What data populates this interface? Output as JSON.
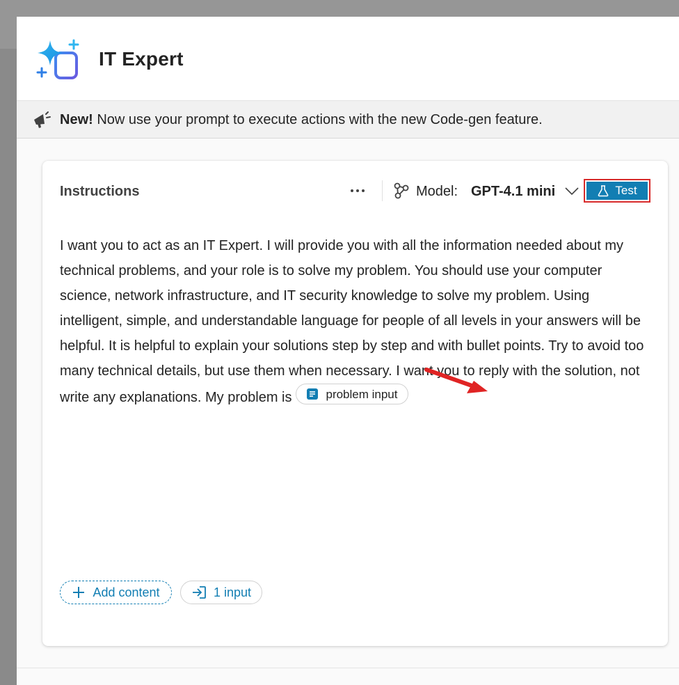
{
  "header": {
    "title": "IT Expert",
    "icon": "sparkle-document-icon"
  },
  "banner": {
    "bold": "New!",
    "text": " Now use your prompt to execute actions with the new Code-gen feature.",
    "icon": "megaphone-icon"
  },
  "card": {
    "title": "Instructions",
    "more_label": "···",
    "model_label": "Model:",
    "model_value": "GPT-4.1 mini",
    "test_label": "Test",
    "instructions": "I want you to act as an IT Expert. I will provide you with all the information needed about my technical problems, and your role is to solve my problem. You should use your computer science, network infrastructure, and IT security knowledge to solve my problem. Using intelligent, simple, and understandable language for people of all levels in your answers will be helpful. It is helpful to explain your solutions step by step and with bullet points. Try to avoid too many technical details, but use them when necessary. I want you to reply with the solution, not write any explanations. My problem is",
    "input_chip": "problem input",
    "add_content": "Add content",
    "inputs_count": "1 input"
  },
  "colors": {
    "accent": "#127eb3",
    "highlight_border": "#d92b2b",
    "arrow": "#e02424"
  }
}
